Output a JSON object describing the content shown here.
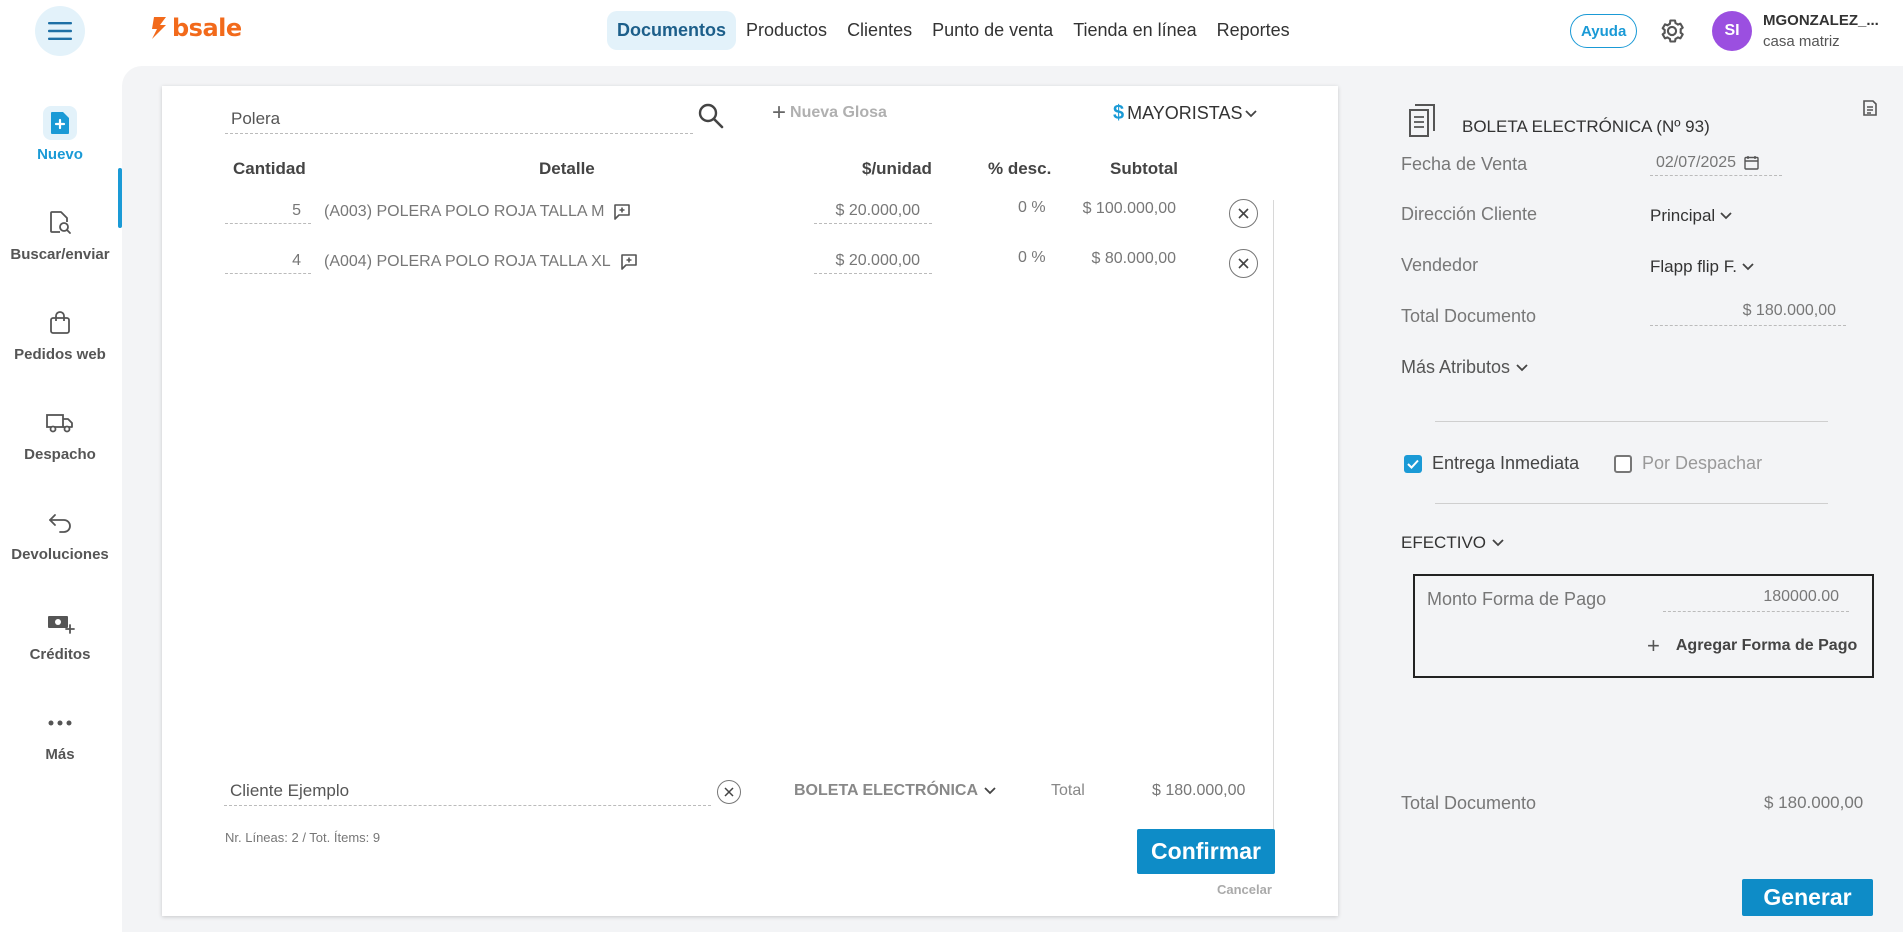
{
  "header": {
    "logo_text": "bsale",
    "nav": [
      "Documentos",
      "Productos",
      "Clientes",
      "Punto de venta",
      "Tienda en línea",
      "Reportes"
    ],
    "help_label": "Ayuda",
    "avatar_initials": "SI",
    "user_name": "MGONZALEZ_...",
    "user_branch": "casa matriz"
  },
  "sidebar": {
    "items": [
      {
        "label": "Nuevo",
        "icon": "new-document-icon"
      },
      {
        "label": "Buscar/enviar",
        "icon": "search-document-icon"
      },
      {
        "label": "Pedidos web",
        "icon": "shopping-bag-icon"
      },
      {
        "label": "Despacho",
        "icon": "truck-icon"
      },
      {
        "label": "Devoluciones",
        "icon": "return-arrow-icon"
      },
      {
        "label": "Créditos",
        "icon": "money-plus-icon"
      },
      {
        "label": "Más",
        "icon": "more-dots-icon"
      }
    ]
  },
  "document": {
    "search_value": "Polera",
    "nueva_glosa_label": "Nueva Glosa",
    "price_list_label": "MAYORISTAS",
    "columns": [
      "Cantidad",
      "Detalle",
      "$/unidad",
      "% desc.",
      "Subtotal"
    ],
    "rows": [
      {
        "qty": "5",
        "detail": "(A003) POLERA POLO ROJA TALLA M",
        "unit_price": "$ 20.000,00",
        "discount": "0 %",
        "subtotal": "$ 100.000,00"
      },
      {
        "qty": "4",
        "detail": "(A004) POLERA POLO ROJA TALLA XL",
        "unit_price": "$ 20.000,00",
        "discount": "0 %",
        "subtotal": "$ 80.000,00"
      }
    ],
    "client_value": "Cliente Ejemplo",
    "doc_type": "BOLETA ELECTRÓNICA",
    "total_label": "Total",
    "total_value": "$ 180.000,00",
    "footer_info": "Nr. Líneas: 2 / Tot. Ítems: 9",
    "confirm_label": "Confirmar",
    "cancel_label": "Cancelar"
  },
  "summary": {
    "doc_title": "BOLETA ELECTRÓNICA (Nº 93)",
    "fecha_label": "Fecha de Venta",
    "fecha_value": "02/07/2025",
    "direccion_label": "Dirección Cliente",
    "direccion_value": "Principal",
    "vendedor_label": "Vendedor",
    "vendedor_value": "Flapp flip F.",
    "total_doc_label": "Total Documento",
    "total_doc_value": "$ 180.000,00",
    "mas_atributos": "Más Atributos",
    "entrega_label": "Entrega Inmediata",
    "entrega_checked": true,
    "despachar_label": "Por Despachar",
    "despachar_checked": false,
    "payment_method": "EFECTIVO",
    "monto_label": "Monto Forma de Pago",
    "monto_value": "180000.00",
    "add_payment_label": "Agregar Forma de Pago",
    "bottom_total_label": "Total Documento",
    "bottom_total_value": "$ 180.000,00",
    "generate_label": "Generar"
  },
  "colors": {
    "accent": "#1a9ad6",
    "button": "#0e8cc7",
    "logo": "#f26a1b",
    "avatar": "#9b4fe0"
  }
}
